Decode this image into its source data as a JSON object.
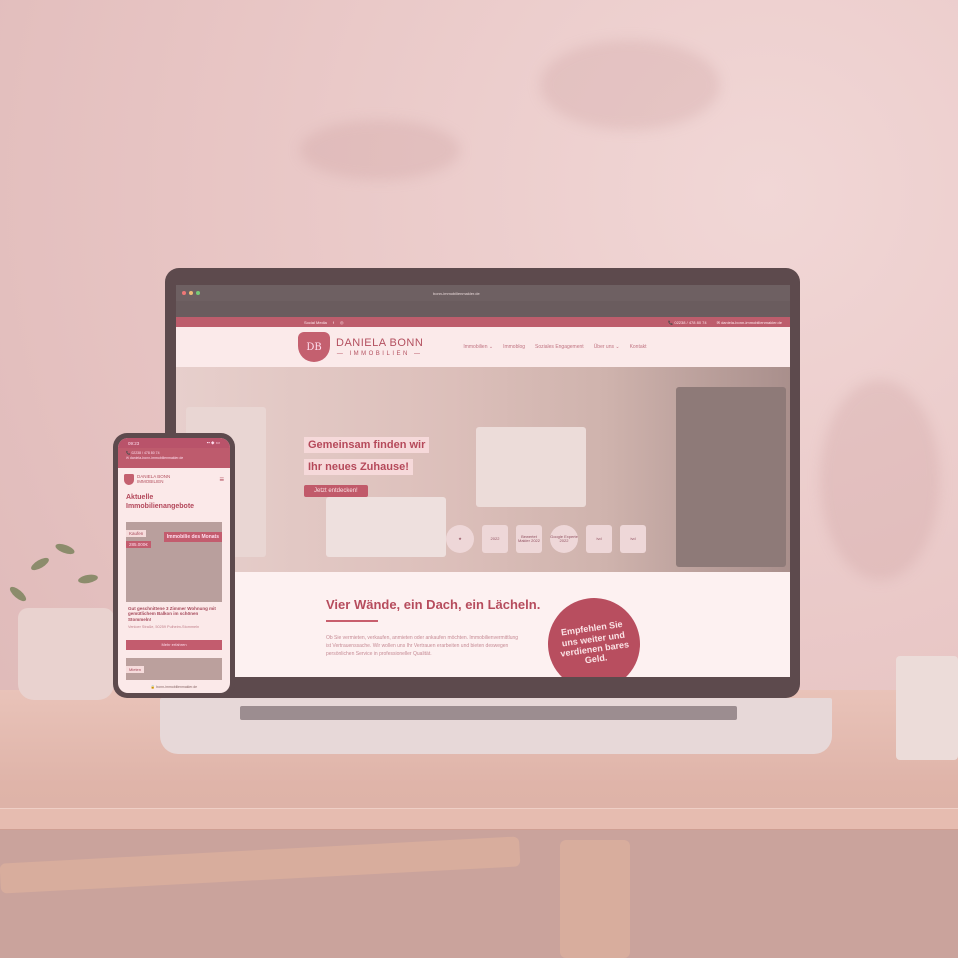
{
  "browser": {
    "url": "bonn-immobilienmakler.de"
  },
  "site": {
    "topbar": {
      "social_label": "Social Media",
      "facebook_icon": "f",
      "instagram_icon": "◎",
      "phone": "📞 02238 / 478 80 74",
      "email": "✉ daniela-bonn-immobilienmakler.de"
    },
    "logo": {
      "crest_letter": "DB",
      "name": "DANIELA BONN",
      "sub": "— IMMOBILIEN —"
    },
    "nav": [
      "Immobilien ⌄",
      "Immoblog",
      "Soziales Engagement",
      "Über uns ⌄",
      "Kontakt"
    ],
    "hero": {
      "line1": "Gemeinsam finden wir",
      "line2": "Ihr neues Zuhause!",
      "cta": "Jetzt entdecken!",
      "badges": [
        "★",
        "2022",
        "Bewertet Makler 2022",
        "Google Experte 2022",
        "ivd",
        "ivd"
      ]
    },
    "section": {
      "title": "Vier Wände, ein Dach, ein Lächeln.",
      "text": "Ob Sie vermieten, verkaufen, anmieten oder ankaufen möchten. Immobilienvermittlung ist Vertrauenssache. Wir wollen uns Ihr Vertrauen erarbeiten und bieten deswegen persönlichen Service in professioneller Qualität.",
      "circle": "Empfehlen Sie uns weiter und verdienen bares Geld."
    }
  },
  "phone": {
    "time": "09:23",
    "signal": "▪▪ ◆ ▭",
    "contact_phone": "📞 02238 / 478 80 74",
    "contact_email": "✉ daniela-bonn-immobilienmakler.de",
    "brand": "DANIELA BONN\nIMMOBILIEN",
    "menu_icon": "≡",
    "section_title": "Aktuelle Immobilienangebote",
    "card": {
      "tag": "Kaufen",
      "price": "285.000€",
      "ribbon": "Immobilie des Monats",
      "title": "Gut geschnittene 3 Zimmer Wohnung mit gemütlichem Balkon im schönen Stommeln!",
      "address": "Venloer Straße, 50259 Pulheim-Stommeln",
      "button": "Mehr erfahren"
    },
    "card2_tag": "Mieten",
    "url": "🔒 bonn-immobilienmakler.de"
  }
}
